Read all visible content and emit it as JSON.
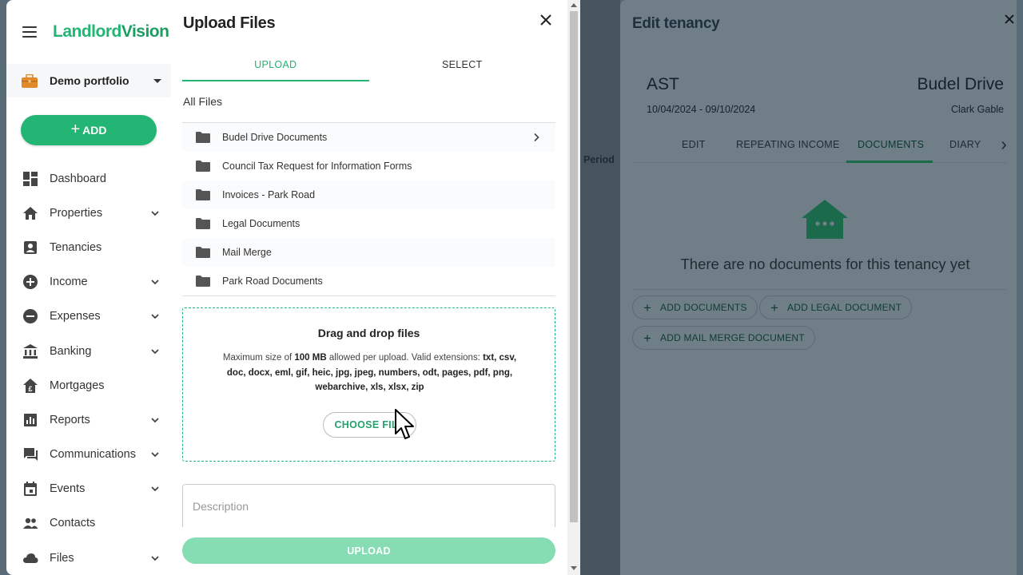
{
  "brand": {
    "logo_text_1": "Landlord",
    "logo_text_2": "Vision"
  },
  "portfolio": {
    "label": "Demo portfolio"
  },
  "add_button": {
    "label": "ADD"
  },
  "nav": [
    {
      "label": "Dashboard",
      "icon": "dashboard-icon",
      "expandable": false
    },
    {
      "label": "Properties",
      "icon": "home-icon",
      "expandable": true
    },
    {
      "label": "Tenancies",
      "icon": "tenancy-icon",
      "expandable": false
    },
    {
      "label": "Income",
      "icon": "plus-circle-icon",
      "expandable": true
    },
    {
      "label": "Expenses",
      "icon": "minus-circle-icon",
      "expandable": true
    },
    {
      "label": "Banking",
      "icon": "bank-icon",
      "expandable": true
    },
    {
      "label": "Mortgages",
      "icon": "mortgage-icon",
      "expandable": false
    },
    {
      "label": "Reports",
      "icon": "bar-chart-icon",
      "expandable": true
    },
    {
      "label": "Communications",
      "icon": "chat-icon",
      "expandable": true
    },
    {
      "label": "Events",
      "icon": "calendar-icon",
      "expandable": true
    },
    {
      "label": "Contacts",
      "icon": "people-icon",
      "expandable": false
    },
    {
      "label": "Files",
      "icon": "cloud-icon",
      "expandable": true
    }
  ],
  "upload_panel": {
    "title": "Upload Files",
    "tabs": [
      {
        "label": "UPLOAD",
        "active": true
      },
      {
        "label": "SELECT",
        "active": false
      }
    ],
    "breadcrumb": "All Files",
    "folders": [
      {
        "name": "Budel Drive Documents",
        "has_chevron": true
      },
      {
        "name": "Council Tax Request for Information Forms",
        "has_chevron": false
      },
      {
        "name": "Invoices - Park Road",
        "has_chevron": false
      },
      {
        "name": "Legal Documents",
        "has_chevron": false
      },
      {
        "name": "Mail Merge",
        "has_chevron": false
      },
      {
        "name": "Park Road Documents",
        "has_chevron": false
      }
    ],
    "dropzone": {
      "title": "Drag and drop files",
      "text_prefix": "Maximum size of ",
      "max_size": "100 MB",
      "text_middle": " allowed per upload. Valid extensions: ",
      "extensions": "txt, csv, doc, docx, eml, gif, heic, jpg, jpeg, numbers, odt, pages, pdf, png, webarchive, xls, xlsx, zip",
      "choose_label": "CHOOSE FILE"
    },
    "description_placeholder": "Description",
    "upload_label": "UPLOAD"
  },
  "edit_tenancy": {
    "side_label": "Period",
    "title": "Edit tenancy",
    "type": "AST",
    "dates": "10/04/2024 - 09/10/2024",
    "property": "Budel Drive",
    "tenant": "Clark Gable",
    "tabs": [
      "EDIT",
      "REPEATING INCOME",
      "DOCUMENTS",
      "DIARY"
    ],
    "active_tab": "DOCUMENTS",
    "empty_message": "There are no documents for this tenancy yet",
    "buttons": [
      "ADD DOCUMENTS",
      "ADD LEGAL DOCUMENT",
      "ADD MAIL MERGE DOCUMENT"
    ]
  },
  "colors": {
    "accent": "#22b573",
    "accent_light": "#86dcb3",
    "overlay": "#5a6b78"
  }
}
